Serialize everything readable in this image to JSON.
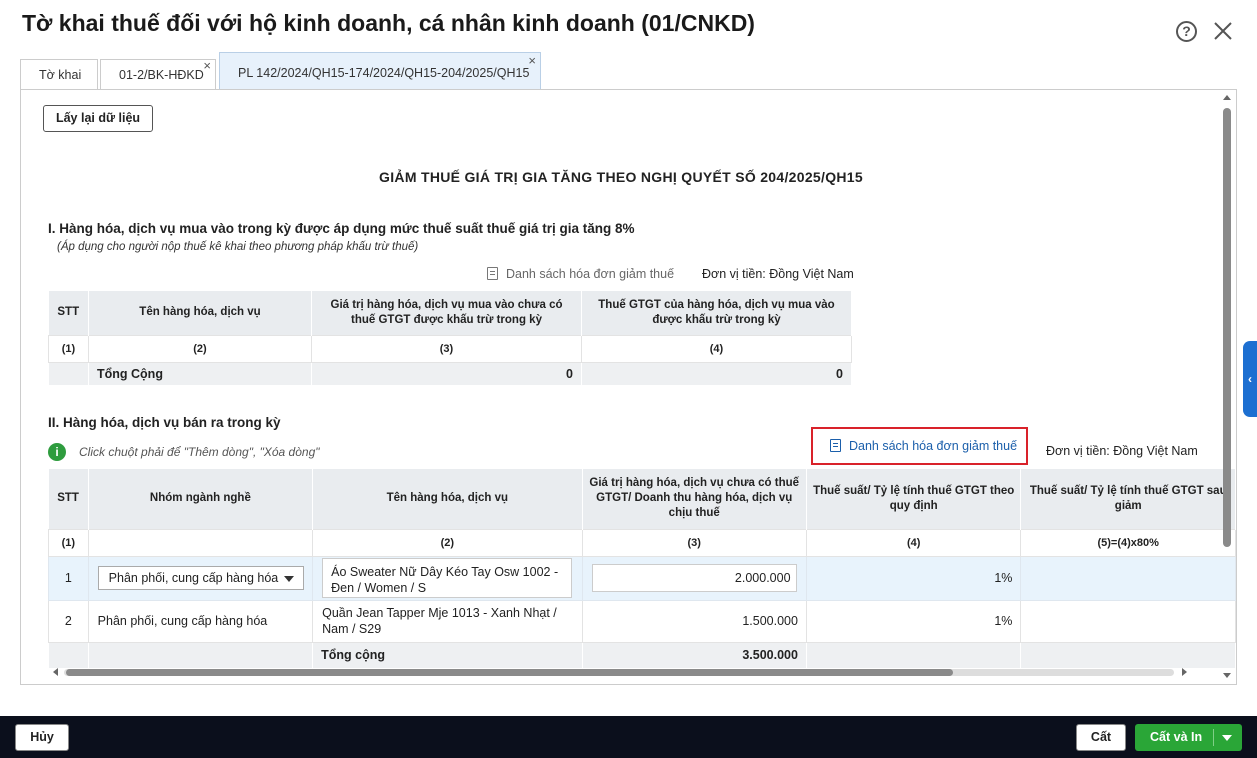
{
  "window": {
    "title": "Tờ khai thuế đối với hộ kinh doanh, cá nhân kinh doanh (01/CNKD)",
    "help_icon": "?",
    "close_icon": "close-icon"
  },
  "tabs": [
    {
      "label": "Tờ khai",
      "closable": false,
      "active": false
    },
    {
      "label": "01-2/BK-HĐKD",
      "closable": true,
      "active": false
    },
    {
      "label": "PL 142/2024/QH15-174/2024/QH15-204/2025/QH15",
      "closable": true,
      "active": true
    }
  ],
  "tab_close": "×",
  "toolbar": {
    "reload_label": "Lấy lại dữ liệu"
  },
  "form": {
    "heading": "GIẢM THUẾ GIÁ TRỊ GIA TĂNG THEO NGHỊ QUYẾT SỐ 204/2025/QH15",
    "section1": {
      "title": "I. Hàng hóa, dịch vụ mua vào trong kỳ được áp dụng mức thuế suất thuế giá trị gia tăng 8%",
      "note": "(Áp dụng cho người nộp thuế kê khai theo phương pháp khấu trừ thuế)",
      "invoice_list_label": "Danh sách hóa đơn giảm thuế",
      "currency_unit": "Đơn vị tiền: Đồng Việt Nam",
      "columns": [
        "STT",
        "Tên hàng hóa, dịch vụ",
        "Giá trị hàng hóa, dịch vụ mua vào chưa có thuế GTGT được khấu trừ trong kỳ",
        "Thuế GTGT của hàng hóa, dịch vụ mua vào được khấu trừ trong kỳ"
      ],
      "index_row": [
        "(1)",
        "(2)",
        "(3)",
        "(4)"
      ],
      "total": {
        "label": "Tổng Cộng",
        "value3": "0",
        "value4": "0"
      }
    },
    "section2": {
      "title": "II. Hàng hóa, dịch vụ bán ra trong kỳ",
      "hint": "Click chuột phải để \"Thêm dòng\", \"Xóa dòng\"",
      "info_icon": "i",
      "invoice_list_label": "Danh sách hóa đơn giảm thuế",
      "currency_unit": "Đơn vị tiền: Đồng Việt Nam",
      "columns": [
        "STT",
        "Nhóm ngành nghề",
        "Tên hàng hóa, dịch vụ",
        "Giá trị hàng hóa, dịch vụ chưa có thuế GTGT/ Doanh thu hàng hóa, dịch vụ chịu thuế",
        "Thuế suất/ Tỷ lệ tính thuế GTGT theo quy định",
        "Thuế suất/ Tỷ lệ tính thuế GTGT sau giảm"
      ],
      "index_row": [
        "(1)",
        "",
        "(2)",
        "(3)",
        "(4)",
        "(5)=(4)x80%"
      ],
      "rows": [
        {
          "stt": "1",
          "group": "Phân phối, cung cấp hàng hóa",
          "name": "Áo  Sweater Nữ Dây Kéo Tay Osw 1002 - Đen / Women / S",
          "value": "2.000.000",
          "rate": "1%",
          "reduced": ""
        },
        {
          "stt": "2",
          "group": "Phân phối, cung cấp hàng hóa",
          "name": "Quần Jean Tapper Mje 1013 - Xanh Nhạt / Nam / S29",
          "value": "1.500.000",
          "rate": "1%",
          "reduced": ""
        }
      ],
      "total": {
        "label": "Tổng cộng",
        "value": "3.500.000"
      }
    }
  },
  "side_tab": "‹",
  "footer": {
    "cancel_label": "Hủy",
    "save_label": "Cất",
    "save_print_label": "Cất và In"
  },
  "colors": {
    "accent_green": "#2aa637",
    "highlight_red": "#d9222a",
    "link_blue": "#1b5fab",
    "footer_bg": "#0b0f1c"
  }
}
